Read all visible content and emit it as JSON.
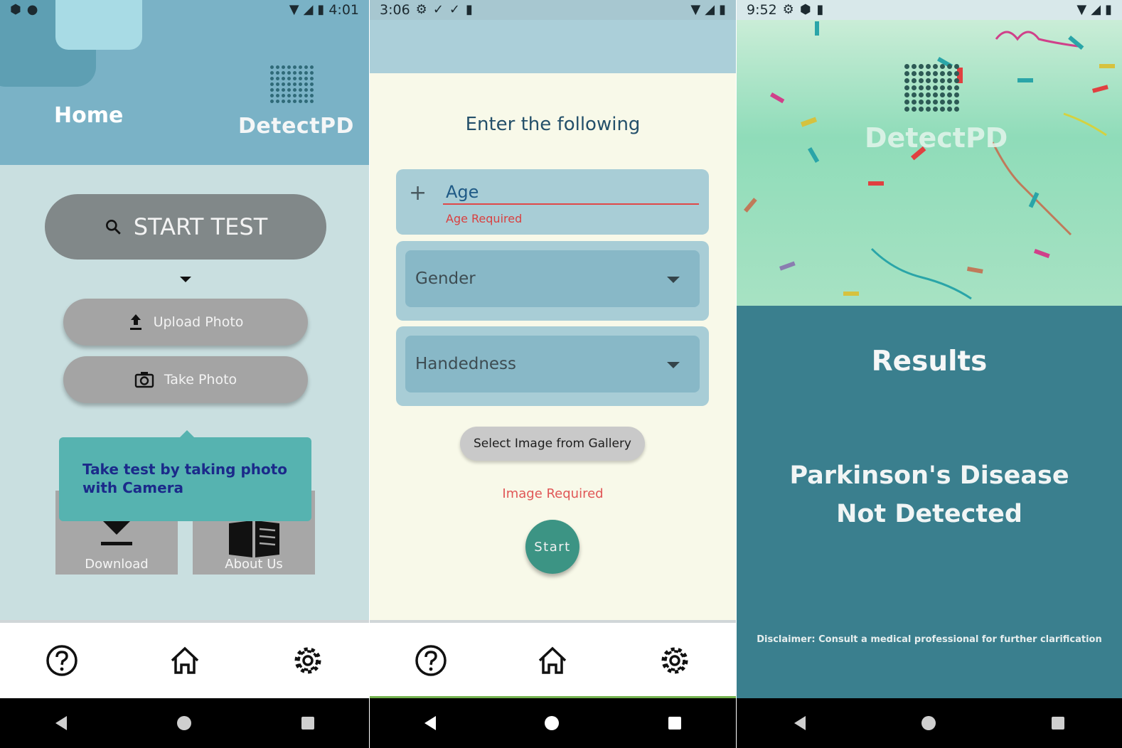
{
  "screens": {
    "home": {
      "status_time": "4:01",
      "title": "Home",
      "brand": "DetectPD",
      "start_test": "START TEST",
      "upload_photo": "Upload Photo",
      "take_photo": "Take Photo",
      "tooltip": "Take test by taking photo with Camera",
      "tile_download": "Download",
      "tile_about": "About Us",
      "nav": [
        "help-icon",
        "home-icon",
        "settings-icon"
      ]
    },
    "form": {
      "status_time": "3:06",
      "title": "Enter the following",
      "age_label": "Age",
      "age_error": "Age Required",
      "gender": "Gender",
      "handedness": "Handedness",
      "gallery_button": "Select Image from Gallery",
      "image_error": "Image Required",
      "start": "Start",
      "nav": [
        "help-icon",
        "home-icon",
        "settings-icon"
      ]
    },
    "results": {
      "status_time": "9:52",
      "brand": "DetectPD",
      "title": "Results",
      "verdict_line1": "Parkinson's Disease",
      "verdict_line2": "Not Detected",
      "disclaimer": "Disclaimer: Consult a medical professional for further clarification"
    }
  },
  "colors": {
    "header_blue": "#7ab2c6",
    "home_bg": "#c9dfe0",
    "form_bg": "#f8f9e9",
    "results_bg": "#3a7f8e",
    "start_teal": "#3c9484",
    "error_red": "#e05656",
    "tooltip_teal": "#56b3b0"
  }
}
